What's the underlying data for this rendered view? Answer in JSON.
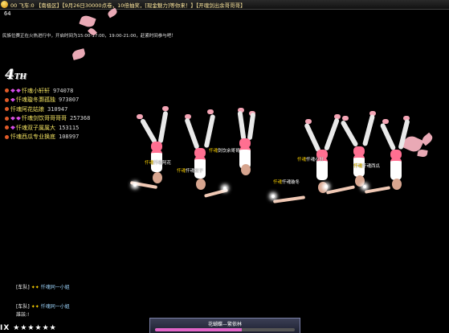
{
  "topbar": {
    "announcement": "00 飞车:0 【南极区】【9月26日30000点卷，10倍抽奖，[现金魅力]等你来！】【开魂剑出余哥哥哥】"
  },
  "counter": "64",
  "notice": "民族位赛正在火热进行中，开启时间为15:00-17:00，19:00-21:00，赶紧时间参与吧！",
  "rank": {
    "number": "4",
    "suffix": "TH"
  },
  "leaderboard": [
    {
      "name": "忏魂小轩轩",
      "score": "974078"
    },
    {
      "name": "忏魂璇冬灏孤独",
      "score": "973807"
    },
    {
      "name": "忏魂阿花姑娘",
      "score": "310947"
    },
    {
      "name": "忏魂剑饮哥哥哥哥",
      "score": "257368"
    },
    {
      "name": "忏魂双子属属大",
      "score": "153115"
    },
    {
      "name": "忏魂西瓜专业换底",
      "score": "108997"
    }
  ],
  "player_labels": [
    {
      "guild": "忏魂",
      "name": "剑饮余哥哥"
    },
    {
      "guild": "忏魂",
      "name": "忏魂阿花"
    },
    {
      "guild": "忏魂",
      "name": "忏魂双子"
    },
    {
      "guild": "忏魂",
      "name": "忏魂小轩"
    },
    {
      "guild": "忏魂",
      "name": "忏魂西瓜"
    },
    {
      "guild": "忏魂",
      "name": "忏魂璇冬"
    }
  ],
  "team_lines": [
    {
      "label": "[车队]",
      "member": "忏魂同一小姐"
    },
    {
      "label": "[车队]",
      "member": "忏魂同一小姐"
    }
  ],
  "chat_line": "誰該:!",
  "bottom": {
    "prefix": "IX",
    "stars": "★★★★★★"
  },
  "song": {
    "title": "花蝴蝶—繁依林",
    "progress": 0.62
  },
  "colors": {
    "accent_pink": "#ff6f91",
    "name_yellow": "#f0e060",
    "petal": "#f6b2bf"
  }
}
